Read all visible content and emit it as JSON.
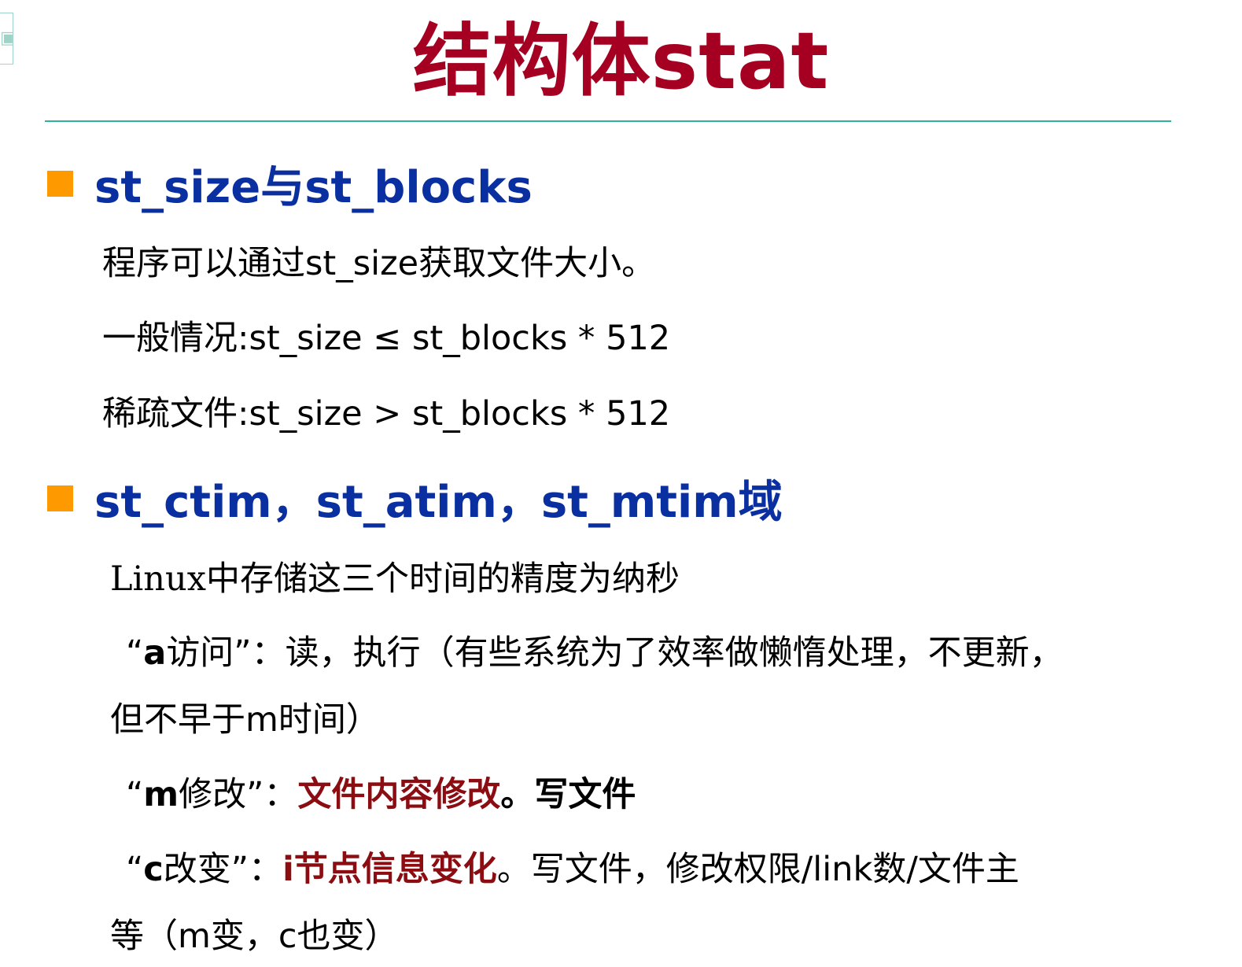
{
  "title": "结构体stat",
  "sections": [
    {
      "heading": "st_size与st_blocks",
      "lines": [
        "程序可以通过st_size获取文件大小。",
        "一般情况:st_size ≤ st_blocks * 512",
        "稀疏文件:st_size > st_blocks * 512"
      ]
    },
    {
      "heading": "st_ctim，st_atim，st_mtim域",
      "intro": "Linux中存储这三个时间的精度为纳秒",
      "atime": {
        "open_quote": "“",
        "key": "a",
        "label": "访问”：",
        "text": "读，执行（有些系统为了效率做懒惰处理，不更新，",
        "text_cont": "但不早于m时间）"
      },
      "mtime": {
        "open_quote": "“",
        "key": "m",
        "label": "修改”：",
        "highlight": "文件内容修改",
        "text": "。写文件"
      },
      "ctime": {
        "open_quote": "“",
        "key": "c",
        "label": "改变”：",
        "highlight": "i节点信息变化",
        "text": "。写文件，修改权限/link数/文件主",
        "text_cont": "等（m变，c也变）"
      }
    }
  ],
  "colors": {
    "title": "#a50021",
    "heading": "#0a2fa0",
    "bullet": "#ff9900",
    "rule": "#2bb39b",
    "highlight": "#8b0d12"
  }
}
